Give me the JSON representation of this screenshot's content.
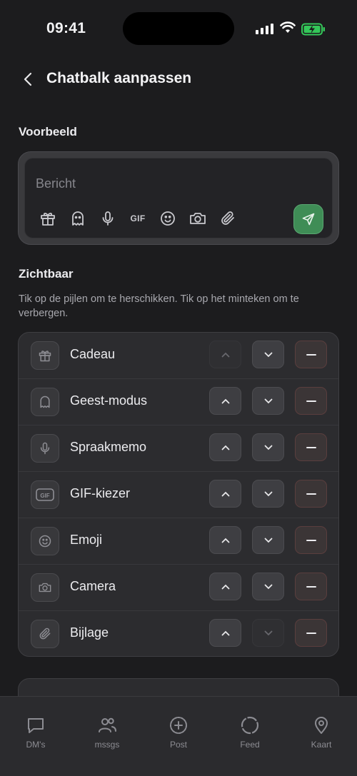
{
  "status_bar": {
    "time": "09:41"
  },
  "header": {
    "title": "Chatbalk aanpassen"
  },
  "preview": {
    "section_label": "Voorbeeld",
    "placeholder": "Bericht",
    "gif_label": "GIF",
    "icons": [
      "gift-icon",
      "ghost-icon",
      "microphone-icon",
      "gif-icon",
      "emoji-icon",
      "camera-icon",
      "paperclip-icon"
    ],
    "send_color": "#3f8d56"
  },
  "visible": {
    "section_label": "Zichtbaar",
    "hint": "Tik op de pijlen om te herschikken. Tik op het minteken om te verbergen.",
    "items": [
      {
        "label": "Cadeau",
        "icon": "gift-icon",
        "up_enabled": false,
        "down_enabled": true
      },
      {
        "label": "Geest-modus",
        "icon": "ghost-icon",
        "up_enabled": true,
        "down_enabled": true
      },
      {
        "label": "Spraakmemo",
        "icon": "microphone-icon",
        "up_enabled": true,
        "down_enabled": true
      },
      {
        "label": "GIF-kiezer",
        "icon": "gif-icon",
        "up_enabled": true,
        "down_enabled": true
      },
      {
        "label": "Emoji",
        "icon": "emoji-icon",
        "up_enabled": true,
        "down_enabled": true
      },
      {
        "label": "Camera",
        "icon": "camera-icon",
        "up_enabled": true,
        "down_enabled": true
      },
      {
        "label": "Bijlage",
        "icon": "paperclip-icon",
        "up_enabled": true,
        "down_enabled": false
      }
    ]
  },
  "tabbar": {
    "tabs": [
      {
        "label": "DM's",
        "icon": "chat-bubble-icon"
      },
      {
        "label": "mssgs",
        "icon": "people-icon"
      },
      {
        "label": "Post",
        "icon": "plus-circle-icon"
      },
      {
        "label": "Feed",
        "icon": "circle-icon"
      },
      {
        "label": "Kaart",
        "icon": "location-pin-icon"
      }
    ]
  },
  "colors": {
    "background": "#1c1c1e",
    "accent": "#3f8d56",
    "remove": "#5a3e3e"
  }
}
